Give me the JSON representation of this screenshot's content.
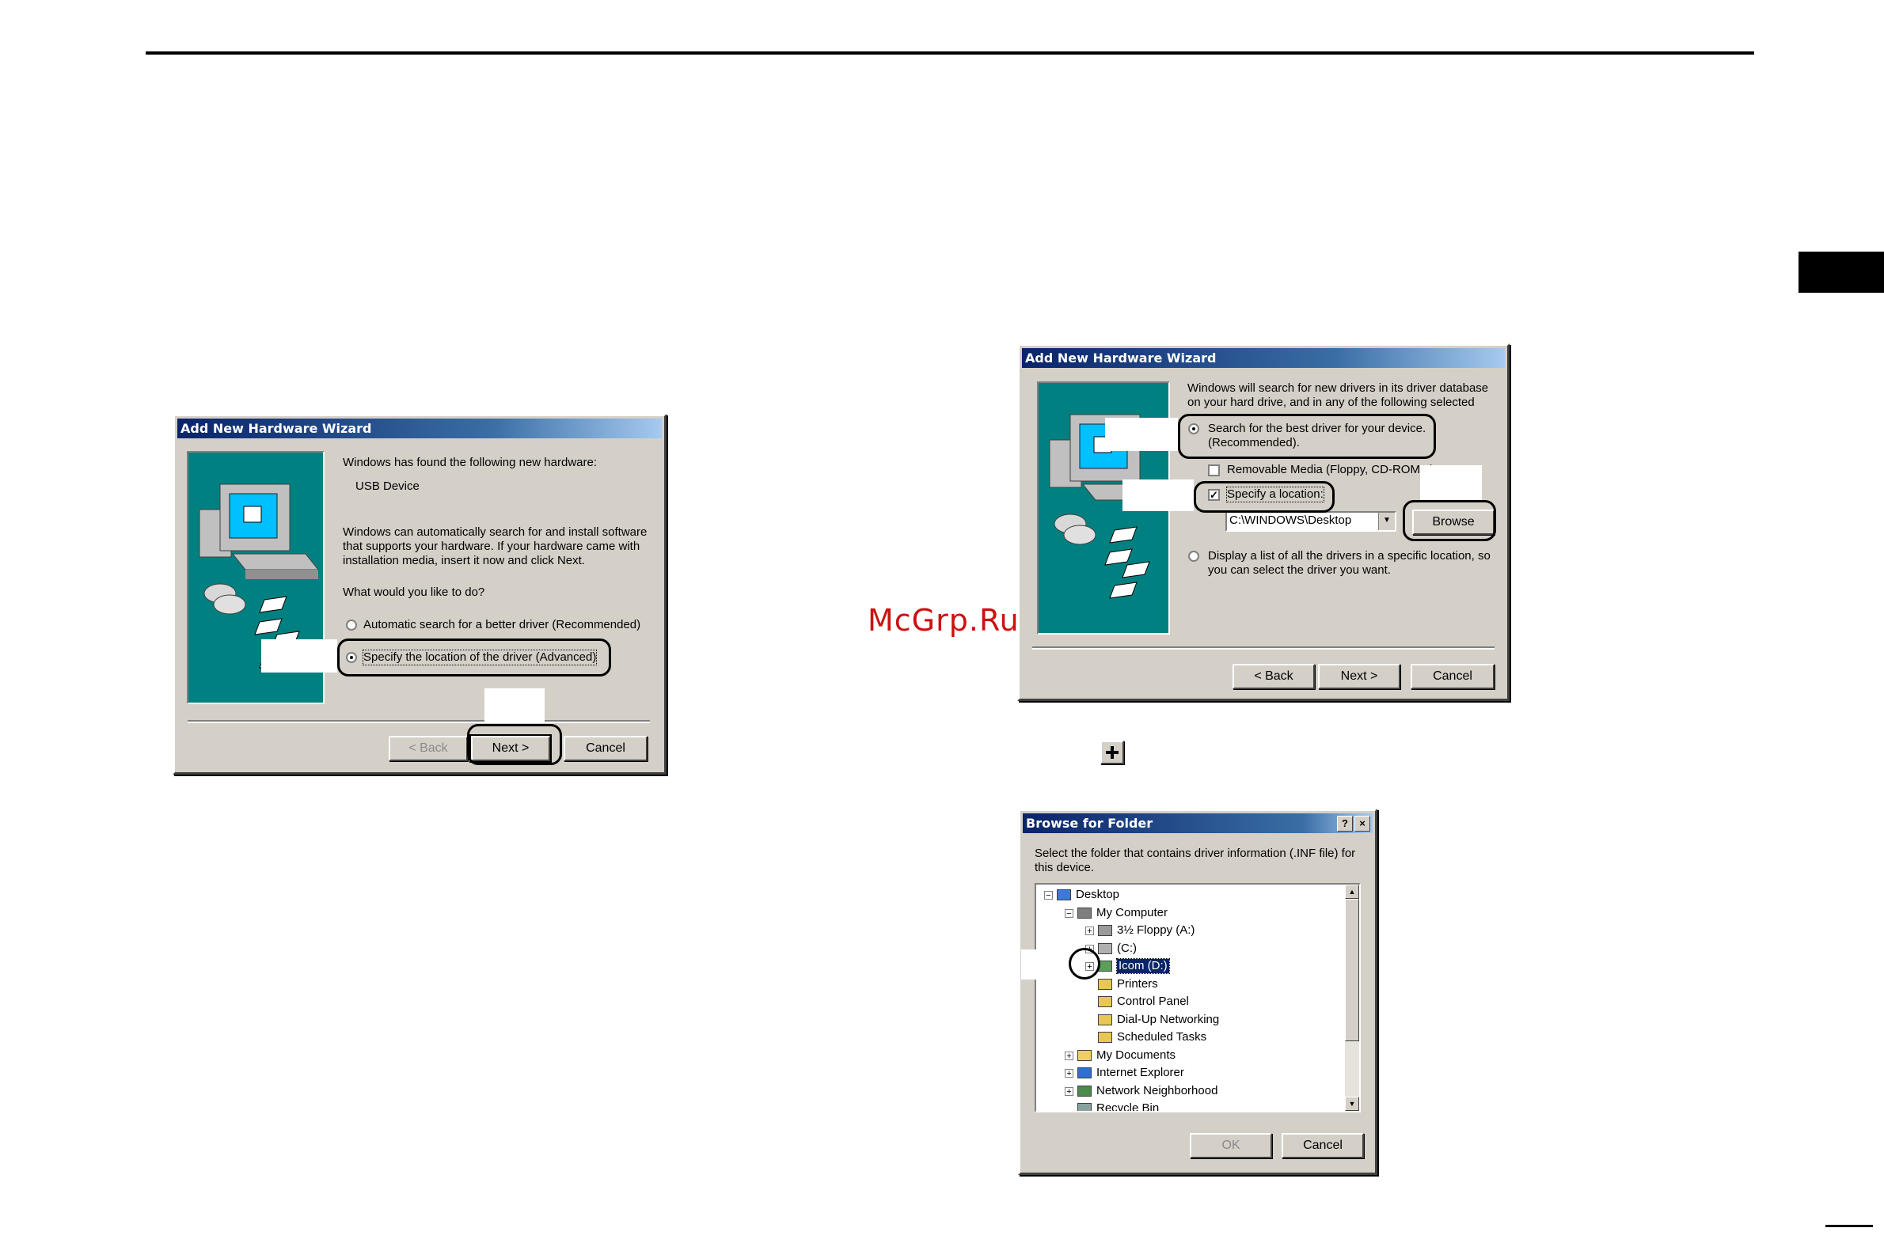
{
  "watermark": "McGrp.Ru",
  "wizard1": {
    "title": "Add New Hardware Wizard",
    "found_text": "Windows has found the following new hardware:",
    "device": "USB Device",
    "para": [
      "Windows can automatically search for and install software",
      "that supports your hardware. If your hardware came with",
      "installation media, insert it now and click Next."
    ],
    "question": "What would you like to do?",
    "option_auto": "Automatic search for a better driver (Recommended)",
    "option_specify": "Specify the location of the driver (Advanced)",
    "back": "< Back",
    "next": "Next >",
    "cancel": "Cancel"
  },
  "wizard2": {
    "title": "Add New Hardware Wizard",
    "intro": [
      "Windows will search for new drivers in its driver database",
      "on your hard drive, and in any of the following selected"
    ],
    "option_search": [
      "Search for the best driver for your device.",
      "(Recommended)."
    ],
    "removable": "Removable Media (Floppy, CD-ROM...)",
    "specify": "Specify a location:",
    "location_value": "C:\\WINDOWS\\Desktop",
    "browse": "Browse",
    "option_list": [
      "Display a list of all the drivers in a specific location, so",
      "you can select the driver you want."
    ],
    "back": "< Back",
    "next": "Next >",
    "cancel": "Cancel"
  },
  "browse": {
    "title": "Browse for Folder",
    "help": "?",
    "close": "×",
    "instructions": [
      "Select the folder that contains driver information (.INF file) for",
      "this device."
    ],
    "tree": [
      {
        "label": "Desktop",
        "toggle": "−",
        "icon": "desktop-icon"
      },
      {
        "label": "My Computer",
        "toggle": "−",
        "icon": "computer-icon"
      },
      {
        "label": "3½ Floppy (A:)",
        "toggle": "+",
        "icon": "floppy-drive-icon"
      },
      {
        "label": "(C:)",
        "toggle": "+",
        "icon": "hard-drive-icon"
      },
      {
        "label": "Icom (D:)",
        "toggle": "+",
        "icon": "cd-drive-icon"
      },
      {
        "label": "Printers",
        "toggle": "",
        "icon": "printers-folder-icon"
      },
      {
        "label": "Control Panel",
        "toggle": "",
        "icon": "control-panel-icon"
      },
      {
        "label": "Dial-Up Networking",
        "toggle": "",
        "icon": "dialup-folder-icon"
      },
      {
        "label": "Scheduled Tasks",
        "toggle": "",
        "icon": "tasks-folder-icon"
      },
      {
        "label": "My Documents",
        "toggle": "+",
        "icon": "folder-icon"
      },
      {
        "label": "Internet Explorer",
        "toggle": "+",
        "icon": "ie-icon"
      },
      {
        "label": "Network Neighborhood",
        "toggle": "+",
        "icon": "network-icon"
      },
      {
        "label": "Recycle Bin",
        "toggle": "",
        "icon": "recycle-bin-icon"
      }
    ],
    "ok": "OK",
    "cancel": "Cancel"
  }
}
